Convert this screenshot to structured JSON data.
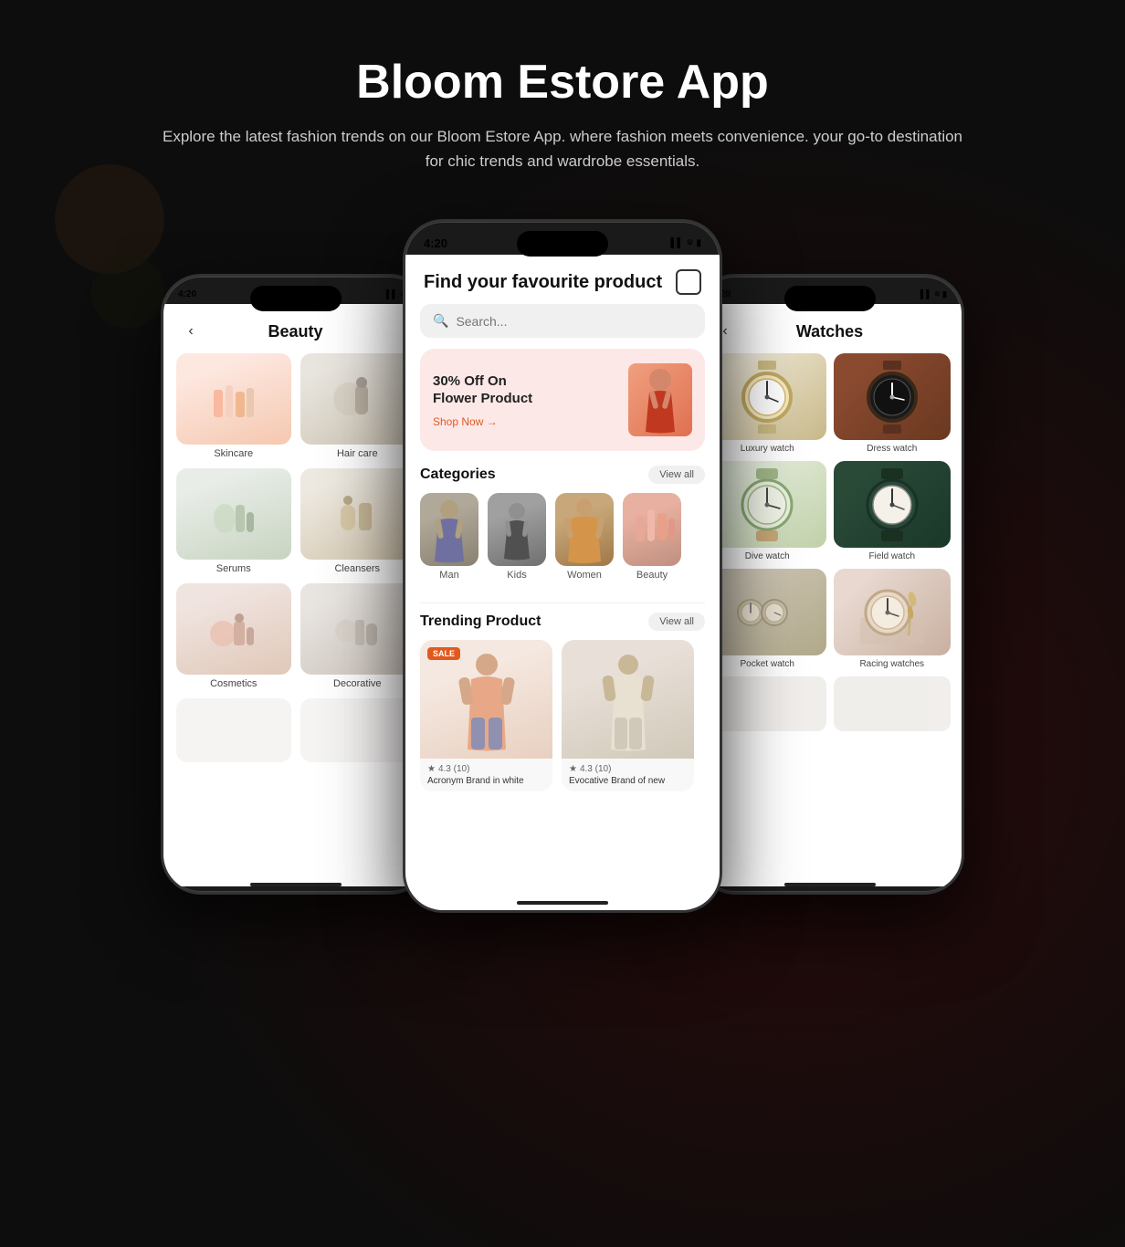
{
  "page": {
    "title": "Bloom Estore App",
    "subtitle": "Explore the latest fashion trends on our Bloom Estore App. where fashion meets convenience. your go-to destination for chic trends and wardrobe essentials."
  },
  "status": {
    "time": "4:20",
    "signal": "▌▌",
    "wifi": "WiFi",
    "battery": "100"
  },
  "centerPhone": {
    "title": "Find your favourite product",
    "search_placeholder": "Search...",
    "banner": {
      "offer": "30% Off On\nFlower Product",
      "cta": "Shop Now →"
    },
    "categories": {
      "title": "Categories",
      "view_all": "View all",
      "items": [
        {
          "name": "Man"
        },
        {
          "name": "Kids"
        },
        {
          "name": "Women"
        },
        {
          "name": "Beauty"
        }
      ]
    },
    "trending": {
      "title": "Trending Product",
      "view_all": "View all",
      "products": [
        {
          "sale": "SALE",
          "rating": "4.3 (10)",
          "name": "Acronym Brand in white"
        },
        {
          "rating": "4.3 (10)",
          "name": "Evocative Brand of new"
        }
      ]
    }
  },
  "leftPhone": {
    "title": "Beauty",
    "categories": [
      {
        "name": "Skincare",
        "emoji": "💄"
      },
      {
        "name": "Hair care",
        "emoji": "🪴"
      },
      {
        "name": "Serums",
        "emoji": "🌿"
      },
      {
        "name": "Cleansers",
        "emoji": "🏺"
      },
      {
        "name": "Cosmetics",
        "emoji": "💅"
      },
      {
        "name": "Decorative",
        "emoji": "✨"
      }
    ]
  },
  "rightPhone": {
    "title": "Watches",
    "categories": [
      {
        "name": "Luxury watch"
      },
      {
        "name": "Dress watch"
      },
      {
        "name": "Dive watch"
      },
      {
        "name": "Field watch"
      },
      {
        "name": "Pocket watch"
      },
      {
        "name": "Racing watches"
      }
    ]
  },
  "icons": {
    "back": "‹",
    "cart": "🛍",
    "search": "🔍",
    "star": "★",
    "arrow": "→"
  }
}
